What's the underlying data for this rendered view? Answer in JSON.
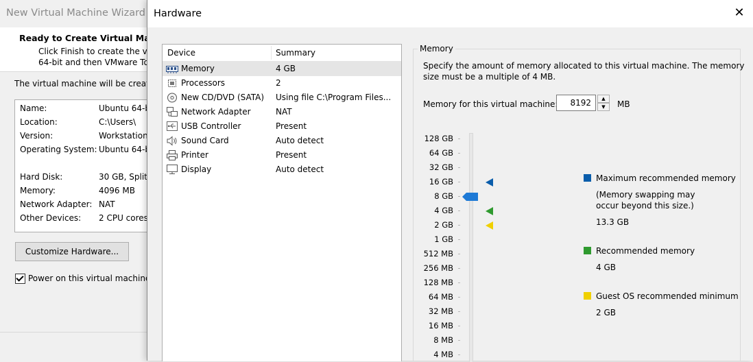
{
  "wizard": {
    "title": "New Virtual Machine Wizard",
    "header_title": "Ready to Create Virtual Mac",
    "header_sub1": "Click Finish to create the vir",
    "header_sub2": "64-bit and then VMware To",
    "desc": "The virtual machine will be create",
    "summary": [
      {
        "label": "Name:",
        "value": "Ubuntu 64-b"
      },
      {
        "label": "Location:",
        "value": "C:\\Users\\"
      },
      {
        "label": "Version:",
        "value": "Workstation"
      },
      {
        "label": "Operating System:",
        "value": "Ubuntu 64-b"
      },
      {
        "label": "Hard Disk:",
        "value": "30 GB, Split"
      },
      {
        "label": "Memory:",
        "value": "4096 MB"
      },
      {
        "label": "Network Adapter:",
        "value": "NAT"
      },
      {
        "label": "Other Devices:",
        "value": "2 CPU cores"
      }
    ],
    "customize_label": "Customize Hardware...",
    "power_on_label": "Power on this virtual machine"
  },
  "dialog": {
    "title": "Hardware",
    "close_glyph": "✕"
  },
  "device_list": {
    "col_device": "Device",
    "col_summary": "Summary",
    "rows": [
      {
        "name": "Memory",
        "summary": "4 GB",
        "icon": "memory-icon",
        "selected": true
      },
      {
        "name": "Processors",
        "summary": "2",
        "icon": "processor-icon"
      },
      {
        "name": "New CD/DVD (SATA)",
        "summary": "Using file C:\\Program Files...",
        "icon": "cd-dvd-icon"
      },
      {
        "name": "Network Adapter",
        "summary": "NAT",
        "icon": "network-icon"
      },
      {
        "name": "USB Controller",
        "summary": "Present",
        "icon": "usb-icon"
      },
      {
        "name": "Sound Card",
        "summary": "Auto detect",
        "icon": "speaker-icon"
      },
      {
        "name": "Printer",
        "summary": "Present",
        "icon": "printer-icon"
      },
      {
        "name": "Display",
        "summary": "Auto detect",
        "icon": "monitor-icon"
      }
    ]
  },
  "memory": {
    "group_label": "Memory",
    "desc1": "Specify the amount of memory allocated to this virtual machine. The memory",
    "desc2": "size must be a multiple of 4 MB.",
    "field_label": "Memory for this virtual machine:",
    "value": "8192",
    "unit": "MB",
    "scale": [
      "128 GB",
      "64 GB",
      "32 GB",
      "16 GB",
      "8 GB",
      "4 GB",
      "2 GB",
      "1 GB",
      "512 MB",
      "256 MB",
      "128 MB",
      "64 MB",
      "32 MB",
      "16 MB",
      "8 MB",
      "4 MB"
    ],
    "current_level": "8 GB",
    "markers": [
      {
        "level": "16 GB",
        "color": "#0a5dab"
      },
      {
        "level": "4 GB",
        "color": "#2f9a2f"
      },
      {
        "level": "2 GB",
        "color": "#f0d000"
      }
    ],
    "thumb_color": "#1e7ad6",
    "legend": {
      "max_label": "Maximum recommended memory",
      "max_note1": "(Memory swapping may",
      "max_note2": "occur beyond this size.)",
      "max_value": "13.3 GB",
      "max_color": "#0a5dab",
      "rec_label": "Recommended memory",
      "rec_value": "4 GB",
      "rec_color": "#2f9a2f",
      "min_label": "Guest OS recommended minimum",
      "min_value": "2 GB",
      "min_color": "#f0d000"
    }
  }
}
